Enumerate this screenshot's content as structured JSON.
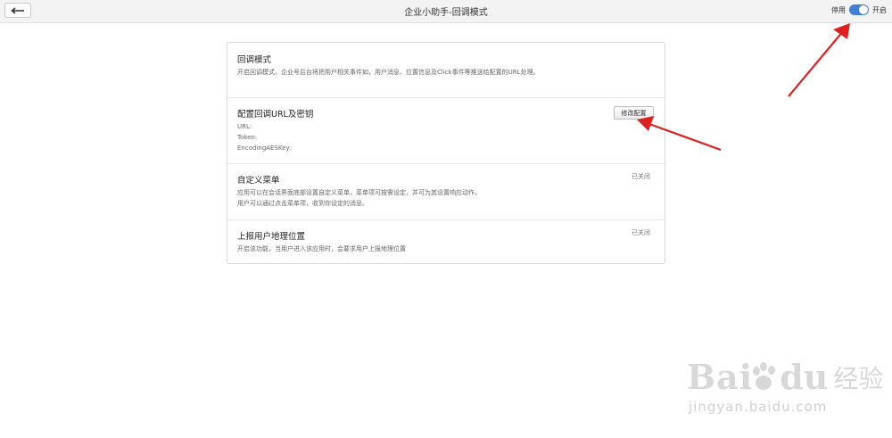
{
  "header": {
    "title": "企业小助手-回调模式",
    "toggle_off_label": "停用",
    "toggle_on_label": "开启",
    "toggle_state": "on"
  },
  "sections": [
    {
      "title": "回调模式",
      "desc": [
        "开启回调模式，企业号后台将把用户相关事件如，用户消息、位置信息及Click事件等推送给配置的URL处理。"
      ]
    },
    {
      "title": "配置回调URL及密钥",
      "fields": [
        "URL:",
        "Token:",
        "EncodingAESKey:"
      ],
      "button": "修改配置"
    },
    {
      "title": "自定义菜单",
      "status": "已关闭",
      "desc": [
        "应用可以在会话界面底部设置自定义菜单，菜单项可按需设定，并可为其设置响应动作。",
        "用户可以通过点击菜单项，收到你设定的消息。"
      ]
    },
    {
      "title": "上报用户地理位置",
      "status": "已关闭",
      "desc": [
        "开启该功能，当用户进入该应用时，会要求用户上报地理位置"
      ]
    }
  ],
  "watermark": {
    "brand_latin": "Bai",
    "brand_du": "du",
    "brand_cn": "经验",
    "url": "jingyan.baidu.com"
  },
  "colors": {
    "toggle_accent": "#3f7fd4",
    "annotation_arrow": "#e02020"
  }
}
